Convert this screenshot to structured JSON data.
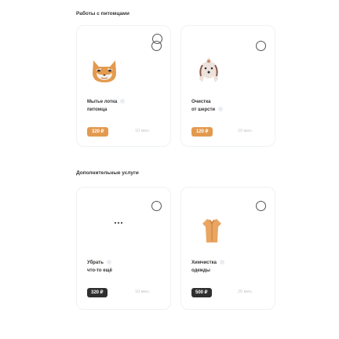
{
  "sections": {
    "pets_title": "Работы с питомцами",
    "extra_title": "Дополнительные услуги"
  },
  "cards": [
    {
      "name_line1": "Мытье лотка",
      "name_line2": "питомца",
      "price": "320 ₽",
      "duration": "10 мин.",
      "icon": "cat-face-icon",
      "price_color": "#e39a4e"
    },
    {
      "name_line1": "Очистка",
      "name_line2": "от шерсти",
      "price": "120 ₽",
      "duration": "10 мин.",
      "icon": "fluffy-dog-icon",
      "price_color": "#e39a4e"
    },
    {
      "name_line1": "Убрать",
      "name_line2": "что-то ещё",
      "price": "320 ₽",
      "duration": "10 мин.",
      "icon": "ellipsis-icon",
      "price_color": "#333333"
    },
    {
      "name_line1": "Химчистка",
      "name_line2": "одежды",
      "price": "500 ₽",
      "duration": "20 мин.",
      "icon": "shirt-icon",
      "price_color": "#333333"
    }
  ]
}
